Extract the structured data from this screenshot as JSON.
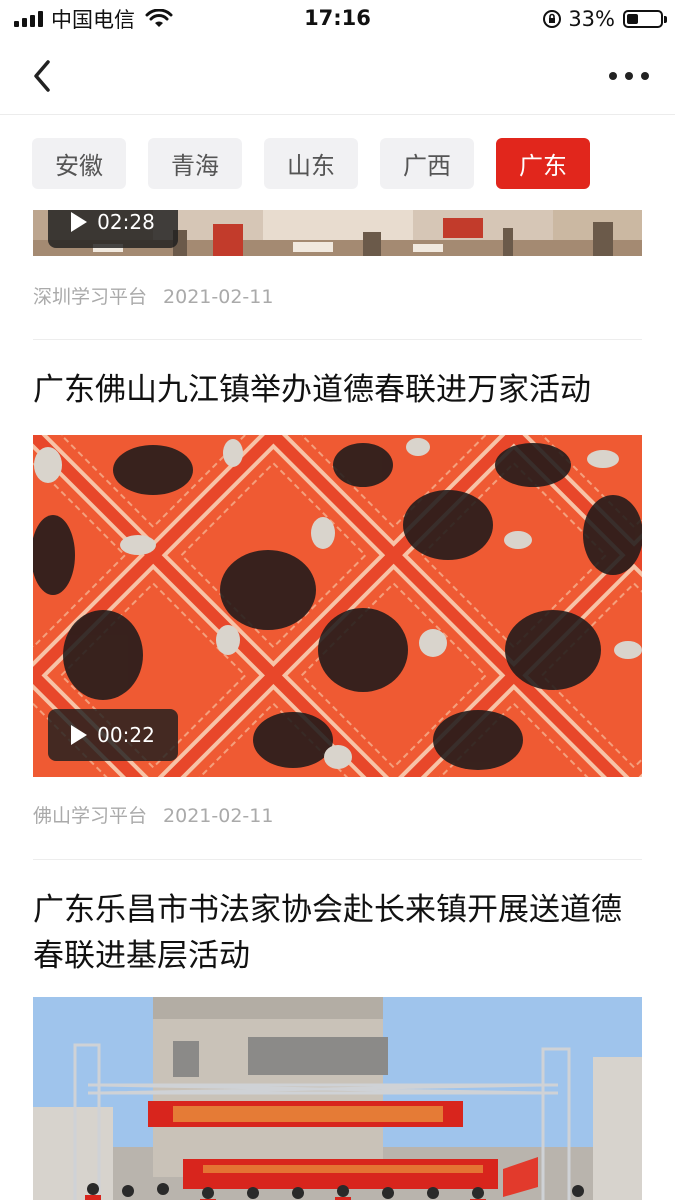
{
  "status_bar": {
    "carrier": "中国电信",
    "time": "17:16",
    "battery_percent": "33%",
    "battery_level": 0.33
  },
  "nav": {
    "back_icon": "chevron-left-icon",
    "more_icon": "more-horizontal-icon"
  },
  "tabs": [
    {
      "label": "安徽",
      "active": false
    },
    {
      "label": "青海",
      "active": false
    },
    {
      "label": "山东",
      "active": false
    },
    {
      "label": "广西",
      "active": false
    },
    {
      "label": "广东",
      "active": true
    }
  ],
  "colors": {
    "accent": "#e1261c",
    "tab_bg": "#f1f1f3",
    "meta_text": "#aaaaaa"
  },
  "feed": [
    {
      "duration": "02:28",
      "source": "深圳学习平台",
      "date": "2021-02-11"
    },
    {
      "title": "广东佛山九江镇举办道德春联进万家活动",
      "duration": "00:22",
      "source": "佛山学习平台",
      "date": "2021-02-11"
    },
    {
      "title": "广东乐昌市书法家协会赴长来镇开展送道德春联进基层活动"
    }
  ]
}
